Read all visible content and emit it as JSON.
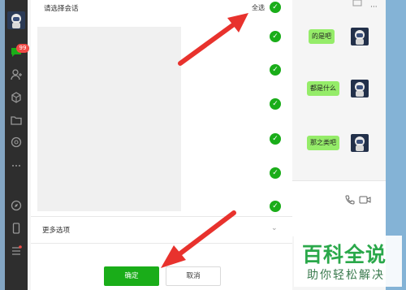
{
  "sidebar": {
    "badge": "99"
  },
  "dialog": {
    "title": "请选择会话",
    "select_all_label": "全选",
    "more_options_label": "更多选项",
    "confirm_label": "确定",
    "cancel_label": "取消",
    "check_glyph": "✓",
    "chevron": "⌄"
  },
  "chat": {
    "messages": [
      "的是吧",
      "都是什么",
      "那之类吧"
    ],
    "more_glyph": "···"
  },
  "watermark": {
    "title": "百科全说",
    "subtitle": "助你轻松解决"
  },
  "colors": {
    "accent_green": "#1aad19",
    "arrow_red": "#e8322d",
    "bubble_green": "#95ec69",
    "sidebar_bg": "#2e2e2e",
    "badge_red": "#f04a45"
  }
}
